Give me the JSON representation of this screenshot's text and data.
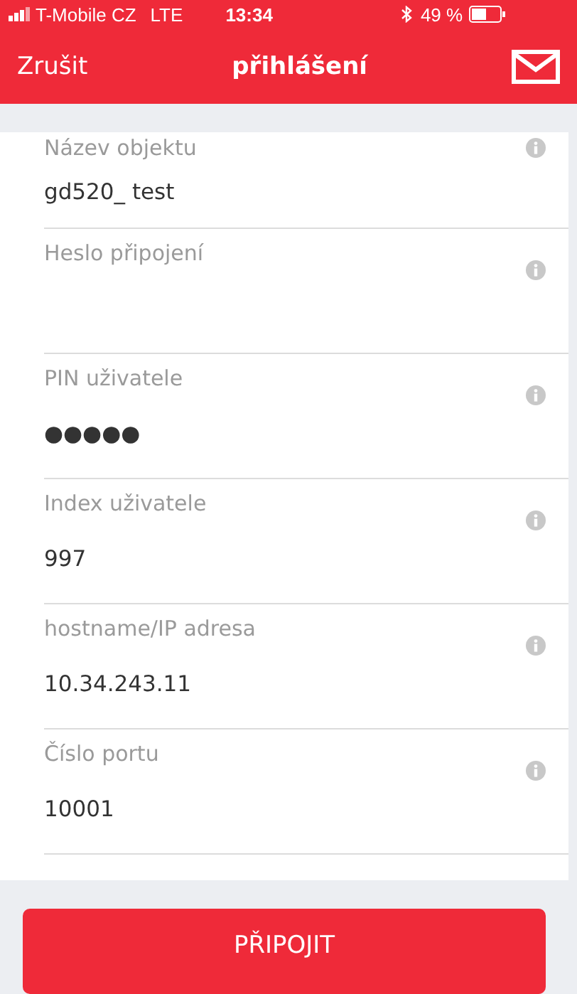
{
  "status_bar": {
    "carrier": "T-Mobile CZ",
    "network": "LTE",
    "time": "13:34",
    "battery": "49 %"
  },
  "nav": {
    "cancel": "Zrušit",
    "title": "přihlášení"
  },
  "fields": [
    {
      "label": "Název objektu",
      "value": "gd520_ test"
    },
    {
      "label": "Heslo připojení"
    },
    {
      "label": "PIN uživatele",
      "value": "●●●●●"
    },
    {
      "label": "Index uživatele",
      "value": "997"
    },
    {
      "label": "hostname/IP adresa",
      "value": "10.34.243.11"
    },
    {
      "label": "Číslo portu",
      "value": "10001"
    }
  ],
  "connect_button": "PŘIPOJIT"
}
